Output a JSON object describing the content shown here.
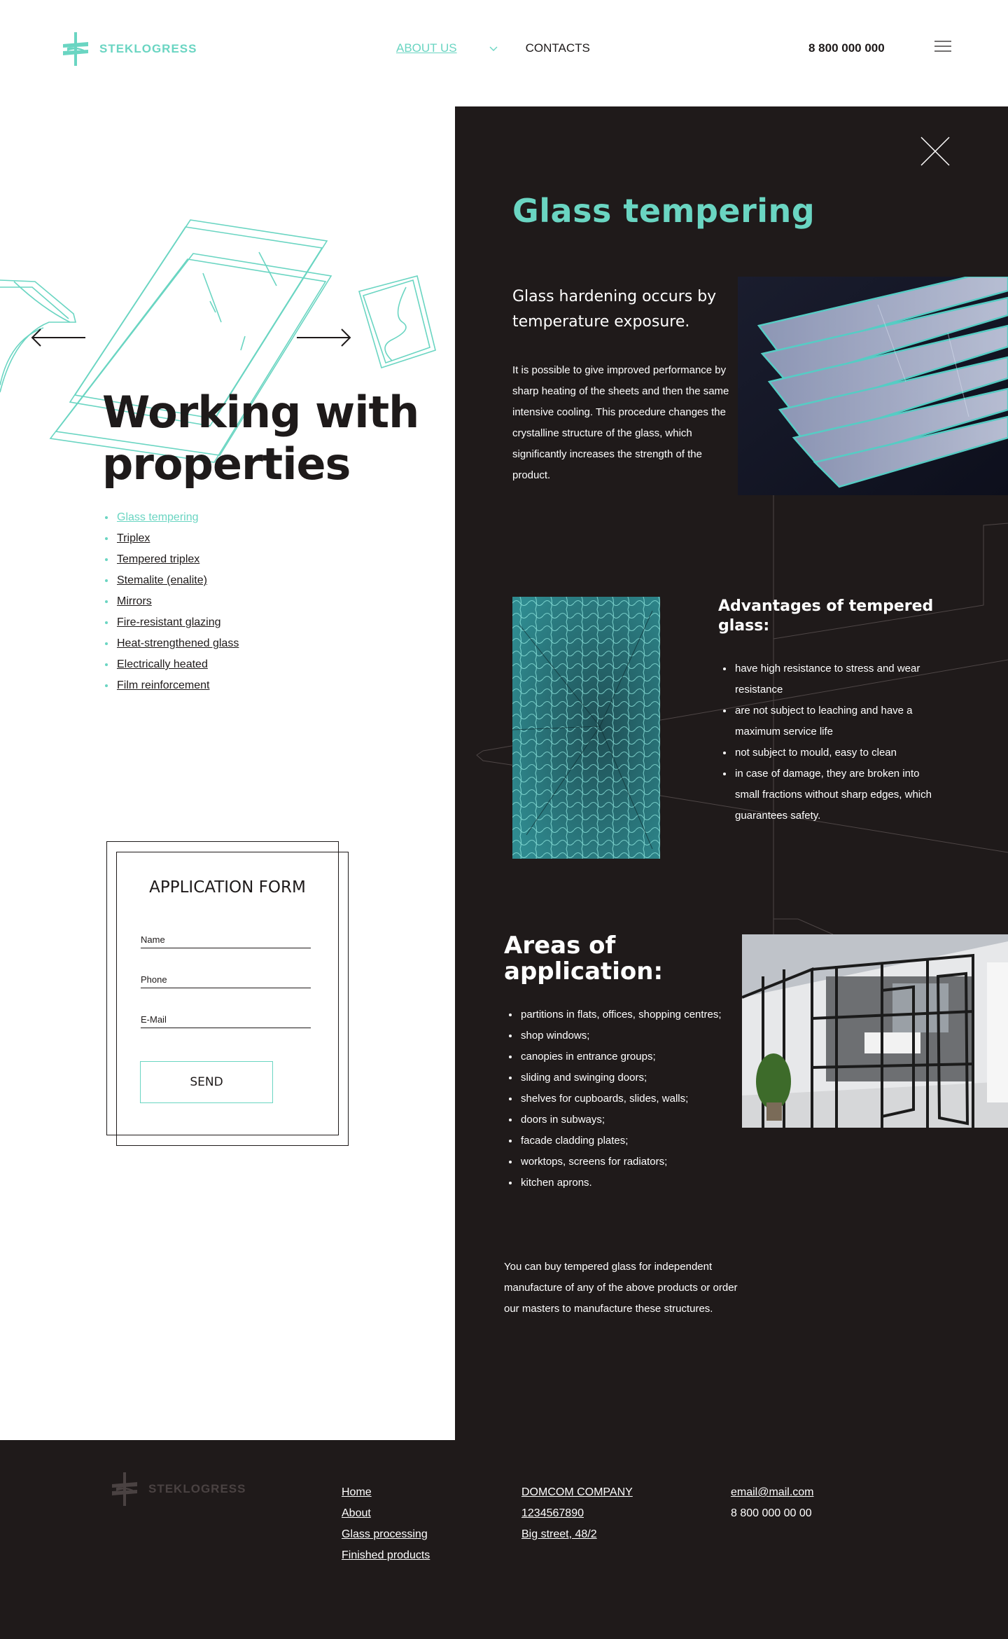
{
  "colors": {
    "accent": "#6ad5c2",
    "dark": "#1f1a1a",
    "text": "#1e1a1a",
    "white": "#ffffff",
    "footer_logo": "#4a4242"
  },
  "header": {
    "logo_text": "STEKLOGRESS",
    "nav": {
      "about": "ABOUT US",
      "contacts": "CONTACTS"
    },
    "phone": "8 800 000 000",
    "icons": {
      "logo": "steklogress-logo-icon",
      "chevron": "chevron-down-icon",
      "menu": "hamburger-menu-icon"
    }
  },
  "hero": {
    "title": "Working with properties",
    "properties": [
      {
        "label": "Glass tempering",
        "active": true
      },
      {
        "label": "Triplex",
        "active": false
      },
      {
        "label": "Tempered triplex",
        "active": false
      },
      {
        "label": "Stemalite (enalite)",
        "active": false
      },
      {
        "label": "Mirrors",
        "active": false
      },
      {
        "label": "Fire-resistant glazing",
        "active": false
      },
      {
        "label": "Heat-strengthened glass",
        "active": false
      },
      {
        "label": "Electrically heated",
        "active": false
      },
      {
        "label": "Film reinforcement",
        "active": false
      }
    ],
    "icons": {
      "prev": "arrow-left-icon",
      "next": "arrow-right-icon"
    }
  },
  "form": {
    "title": "APPLICATION FORM",
    "name_placeholder": "Name",
    "phone_placeholder": "Phone",
    "email_placeholder": "E-Mail",
    "send_label": "SEND"
  },
  "panel": {
    "title": "Glass tempering",
    "lead": "Glass hardening occurs by temperature exposure.",
    "intro": "It is possible to give improved performance by sharp heating of the sheets and then the same intensive cooling. This procedure changes the crystalline structure of the glass, which significantly increases the strength of the product.",
    "advantages_title": "Advantages of tempered glass:",
    "advantages": [
      "have high resistance to stress and wear resistance",
      "are not subject to leaching and have a maximum service life",
      "not subject to mould, easy to clean",
      "in case of damage, they are broken into small fractions without sharp edges, which guarantees safety."
    ],
    "areas_title": "Areas of application:",
    "areas": [
      "partitions in flats, offices, shopping centres;",
      "shop windows;",
      "canopies in entrance groups;",
      "sliding and swinging doors;",
      "shelves for cupboards, slides, walls;",
      "doors in subways;",
      "facade cladding plates;",
      "worktops, screens for radiators;",
      "kitchen aprons."
    ],
    "outro": "You can buy tempered glass for independent manufacture of any of the above products or order our masters to manufacture these structures.",
    "icons": {
      "close": "close-icon"
    }
  },
  "footer": {
    "logo_text": "STEKLOGRESS",
    "nav": [
      "Home",
      "About",
      "Glass processing",
      "Finished products"
    ],
    "company": [
      "DOMCOM COMPANY",
      "1234567890",
      "Big street, 48/2"
    ],
    "email": "email@mail.com",
    "phone": "8 800 000 00 00"
  }
}
